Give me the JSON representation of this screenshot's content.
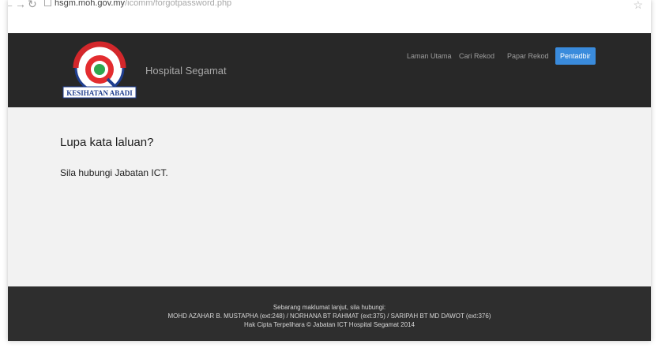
{
  "browser": {
    "url_domain": "hsgm.moh.gov.my",
    "url_path": "/icomm/forgotpassword.php",
    "back_icon": "back-arrow-icon",
    "forward_icon": "forward-arrow-icon",
    "reload_icon": "reload-icon"
  },
  "header": {
    "brand": "Hospital Segamat",
    "logo_caption": "KESIHATAN ABADI",
    "nav": [
      {
        "label": "Laman Utama"
      },
      {
        "label": "Cari Rekod"
      },
      {
        "label": "Papar Rekod"
      },
      {
        "label": "Pentadbir",
        "active": true
      }
    ],
    "colors": {
      "bar": "#282828",
      "active": "#3a8bdc"
    }
  },
  "main": {
    "title": "Lupa kata laluan?",
    "message": "Sila hubungi Jabatan ICT."
  },
  "footer": {
    "line1": "Sebarang maklumat lanjut, sila hubungi:",
    "line2": "MOHD AZAHAR B. MUSTAPHA (ext:248) / NORHANA BT RAHMAT (ext:375) / SARIPAH BT MD DAWOT (ext:376)",
    "line3": "Hak Cipta Terpelihara © Jabatan ICT Hospital Segamat 2014"
  }
}
